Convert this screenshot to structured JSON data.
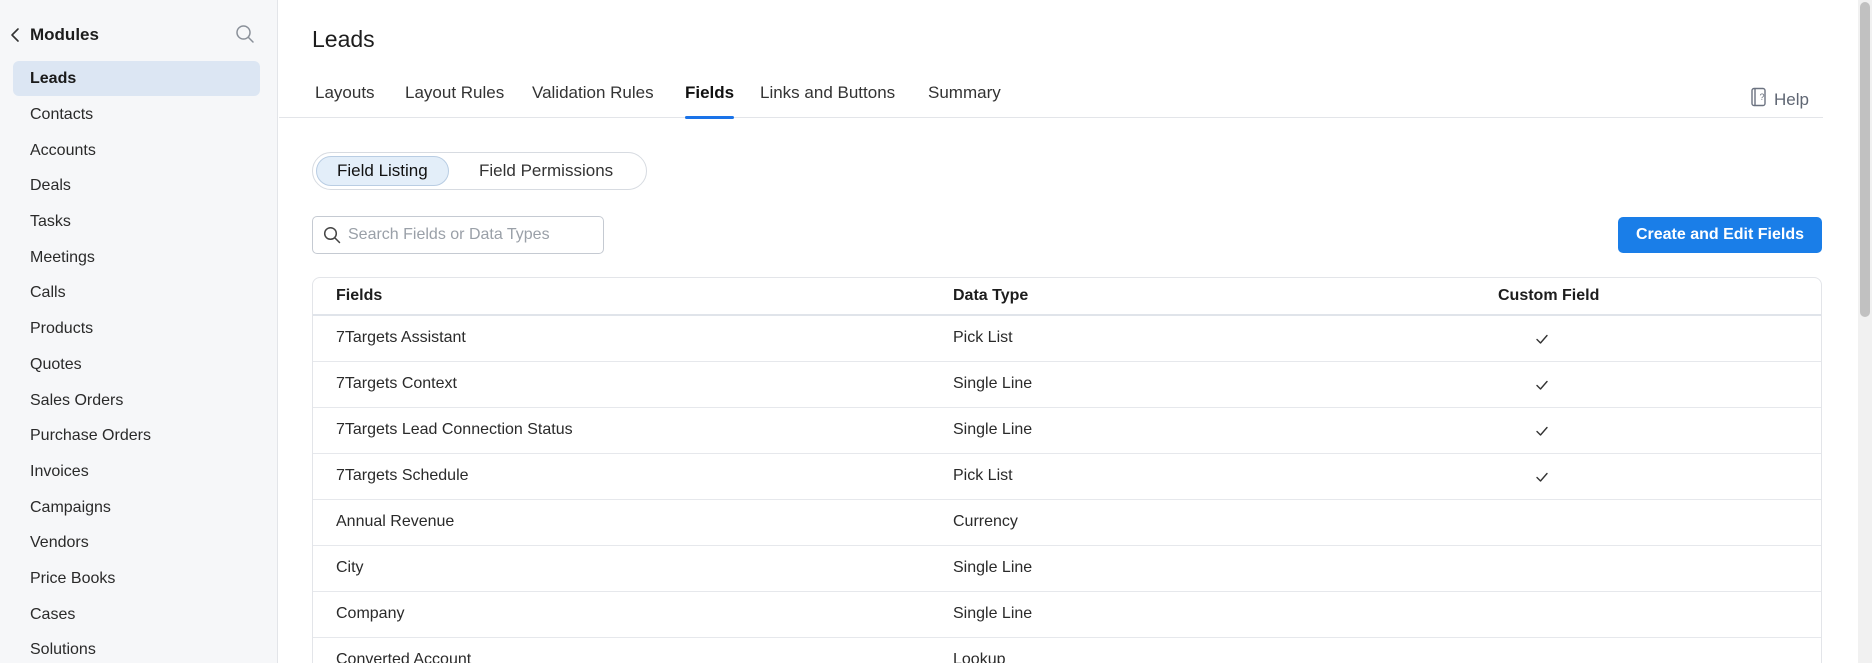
{
  "sidebar": {
    "title": "Modules",
    "items": [
      {
        "label": "Leads",
        "active": true
      },
      {
        "label": "Contacts"
      },
      {
        "label": "Accounts"
      },
      {
        "label": "Deals"
      },
      {
        "label": "Tasks"
      },
      {
        "label": "Meetings"
      },
      {
        "label": "Calls"
      },
      {
        "label": "Products"
      },
      {
        "label": "Quotes"
      },
      {
        "label": "Sales Orders"
      },
      {
        "label": "Purchase Orders"
      },
      {
        "label": "Invoices"
      },
      {
        "label": "Campaigns"
      },
      {
        "label": "Vendors"
      },
      {
        "label": "Price Books"
      },
      {
        "label": "Cases"
      },
      {
        "label": "Solutions"
      }
    ]
  },
  "main": {
    "title": "Leads",
    "tabs": [
      {
        "label": "Layouts"
      },
      {
        "label": "Layout Rules"
      },
      {
        "label": "Validation Rules"
      },
      {
        "label": "Fields",
        "active": true
      },
      {
        "label": "Links and Buttons"
      },
      {
        "label": "Summary"
      }
    ],
    "help_label": "Help",
    "segments": [
      {
        "label": "Field Listing",
        "active": true
      },
      {
        "label": "Field Permissions"
      }
    ],
    "search": {
      "placeholder": "Search Fields or Data Types",
      "value": ""
    },
    "create_button_label": "Create and Edit Fields",
    "table": {
      "headers": {
        "fields": "Fields",
        "data_type": "Data Type",
        "custom_field": "Custom Field"
      },
      "rows": [
        {
          "field": "7Targets Assistant",
          "data_type": "Pick List",
          "custom": true
        },
        {
          "field": "7Targets Context",
          "data_type": "Single Line",
          "custom": true
        },
        {
          "field": "7Targets Lead Connection Status",
          "data_type": "Single Line",
          "custom": true
        },
        {
          "field": "7Targets Schedule",
          "data_type": "Pick List",
          "custom": true
        },
        {
          "field": "Annual Revenue",
          "data_type": "Currency",
          "custom": false
        },
        {
          "field": "City",
          "data_type": "Single Line",
          "custom": false
        },
        {
          "field": "Company",
          "data_type": "Single Line",
          "custom": false
        },
        {
          "field": "Converted Account",
          "data_type": "Lookup",
          "custom": false
        }
      ]
    }
  },
  "colors": {
    "accent": "#1a7ee8",
    "active_nav_bg": "#dce6f3",
    "tab_underline": "#1a73e8"
  }
}
